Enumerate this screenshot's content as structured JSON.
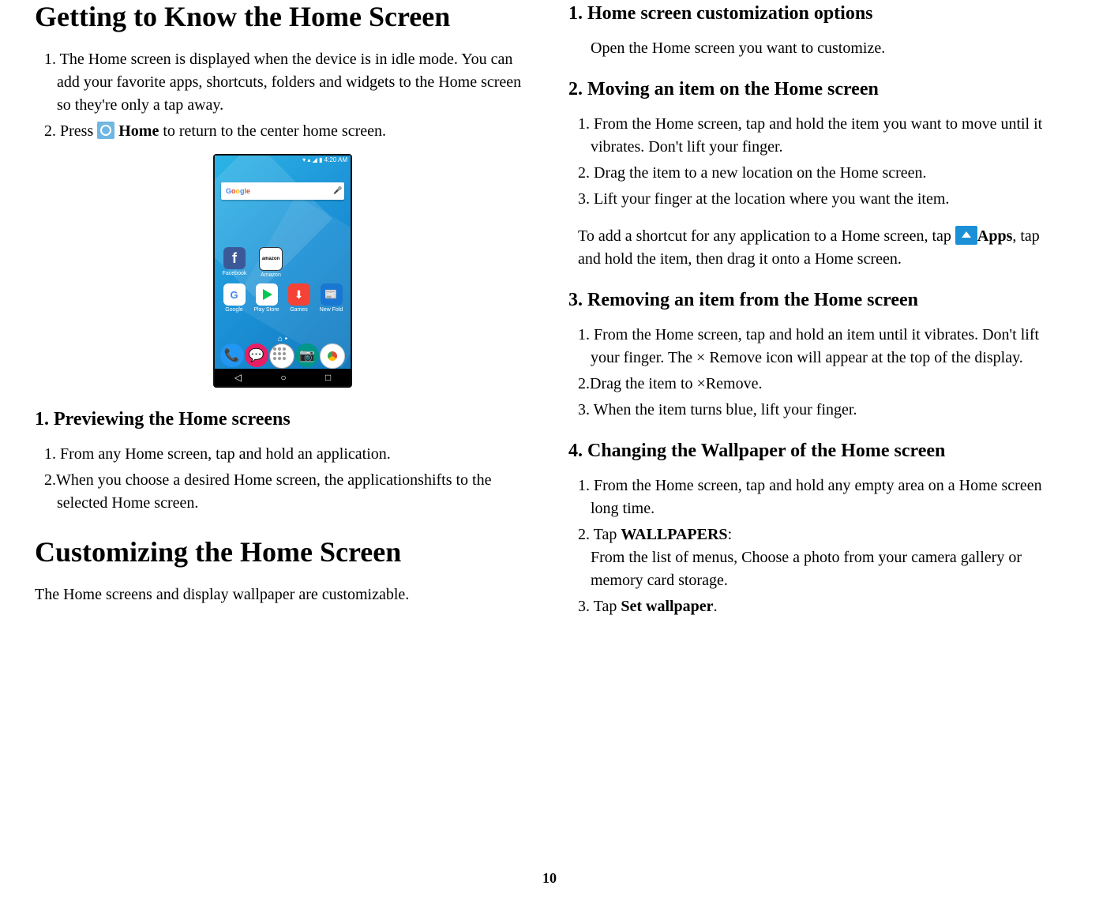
{
  "page_number": "10",
  "left": {
    "h1": "Getting to Know the Home Screen",
    "p1": "1. The Home screen is displayed when the device is in idle mode. You can add your favorite apps, shortcuts, folders and widgets to the Home screen so they're only a tap away.",
    "p2_a": "2. Press ",
    "p2_b": " Home",
    "p2_c": " to return to the center home screen.",
    "phone": {
      "time": "4:20 AM",
      "search_brand": "Google",
      "apps_row1": [
        {
          "label": "Facebook"
        },
        {
          "label": "Amazon"
        }
      ],
      "apps_row2": [
        {
          "label": "Google"
        },
        {
          "label": "Play Store"
        },
        {
          "label": "Games"
        },
        {
          "label": "New Fold"
        }
      ]
    },
    "sec1_h": "1. Previewing the Home screens",
    "sec1_l1": "1. From any Home screen, tap and hold an application.",
    "sec1_l2": "2.When you choose a desired Home screen, the applicationshifts to the selected Home screen.",
    "h1b": "Customizing the Home Screen",
    "p_custom": "The Home screens and display wallpaper are customizable."
  },
  "right": {
    "sec1_h": "1.  Home screen customization options",
    "sec1_l1": "Open the Home screen you want to customize.",
    "sec2_h": "2. Moving an item on the Home screen",
    "sec2_l1": "1. From the Home screen, tap and hold the item you want to move until it vibrates. Don't lift your finger.",
    "sec2_l2": "2. Drag the item to a new location on the Home screen.",
    "sec2_l3": "3. Lift your finger at the location where you want the item.",
    "sec2_tip_a": "To add a shortcut for any application to a Home screen, tap ",
    "sec2_tip_b": "Apps",
    "sec2_tip_c": ", tap and hold the item, then drag it onto a Home screen.",
    "sec3_h": "3. Removing an item from the Home screen",
    "sec3_l1": "1. From the Home screen, tap and hold an item until it vibrates. Don't lift your finger. The × Remove icon will appear at the top of the display.",
    "sec3_l2": "2.Drag the item to ×Remove.",
    "sec3_l3": "3. When the item turns blue, lift your finger.",
    "sec4_h": "4. Changing the Wallpaper of the Home screen",
    "sec4_l1": "1. From the Home screen, tap and hold any empty area on a Home screen long time.",
    "sec4_l2_a": "2. Tap ",
    "sec4_l2_b": "WALLPAPERS",
    "sec4_l2_c": ":",
    "sec4_l2_d": "From the list of menus, Choose a photo from your camera gallery or memory card storage.",
    "sec4_l3_a": "3. Tap ",
    "sec4_l3_b": "Set wallpaper",
    "sec4_l3_c": "."
  }
}
